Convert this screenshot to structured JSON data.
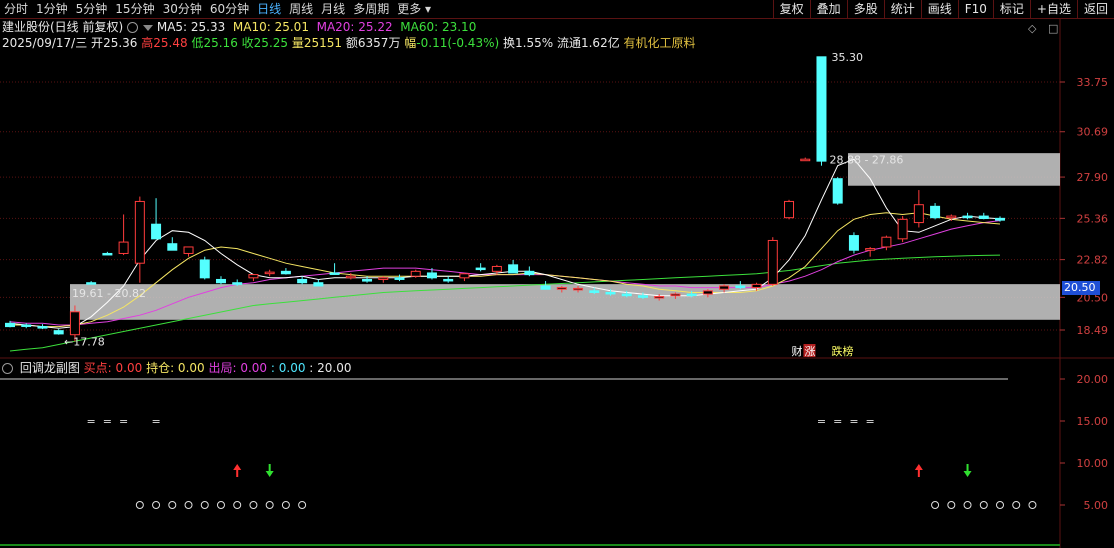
{
  "toolbar": {
    "tabs": [
      "分时",
      "1分钟",
      "5分钟",
      "15分钟",
      "30分钟",
      "60分钟",
      "日线",
      "周线",
      "月线",
      "多周期",
      "更多"
    ],
    "active_tab": "日线",
    "right_buttons": [
      "复权",
      "叠加",
      "多股",
      "统计",
      "画线",
      "F10",
      "标记",
      "+自选",
      "返回"
    ]
  },
  "header": {
    "stock_title": "建业股份(日线 前复权)",
    "ma5": "MA5: 25.33",
    "ma10": "MA10: 25.01",
    "ma20": "MA20: 25.22",
    "ma60": "MA60: 23.10",
    "date": "2025/09/17/三",
    "open_label": "开",
    "open": "25.36",
    "high_label": "高",
    "high": "25.48",
    "low_label": "低",
    "low": "25.16",
    "close_label": "收",
    "close": "25.25",
    "vol_label": "量",
    "vol": "25151",
    "amount_label": "额",
    "amount": "6357万",
    "change_label": "幅",
    "change": "-0.11(-0.43%)",
    "turnover_label": "换",
    "turnover": "1.55%",
    "float_label": "流通",
    "float": "1.62亿",
    "industry": "有机化工原料",
    "diamond": "◇",
    "box_icon": "□"
  },
  "price_tag": "20.50",
  "sub_header": {
    "name": "回调龙副图",
    "buy": "买点: 0.00",
    "hold": "持仓: 0.00",
    "exit": "出局: 0.00",
    "v1": ": 0.00",
    "v2": ": 20.00"
  },
  "colors": {
    "up": "#ff3c3c",
    "down": "#54ffff",
    "ma5": "#ffffff",
    "ma10": "#f5e663",
    "ma20": "#e040e0",
    "ma60": "#3ce03c",
    "grid": "#5a1212",
    "band": "#cfcfcf"
  },
  "chart_data": [
    {
      "type": "candlestick",
      "title": "建业股份(日线 前复权)",
      "y_ticks": [
        18.49,
        20.5,
        22.82,
        25.36,
        27.9,
        30.69,
        33.75
      ],
      "ylim": [
        17.5,
        36.0
      ],
      "annotations": [
        "35.30",
        "28.88 - 27.86",
        "19.61 - 20.82",
        "17.78"
      ],
      "event_labels": [
        "财",
        "涨",
        "跌榜"
      ],
      "zones": [
        {
          "label": "19.61 - 20.82",
          "low": 19.61,
          "high": 20.82
        },
        {
          "label": "28.88 - 27.86",
          "low": 27.86,
          "high": 28.88
        }
      ],
      "candles": [
        {
          "o": 18.9,
          "h": 19.05,
          "l": 18.65,
          "c": 18.7
        },
        {
          "o": 18.8,
          "h": 18.9,
          "l": 18.6,
          "c": 18.72
        },
        {
          "o": 18.7,
          "h": 18.85,
          "l": 18.55,
          "c": 18.65
        },
        {
          "o": 18.45,
          "h": 18.55,
          "l": 18.2,
          "c": 18.25
        },
        {
          "o": 18.2,
          "h": 20.0,
          "l": 17.78,
          "c": 19.61
        },
        {
          "o": 21.4,
          "h": 21.5,
          "l": 21.3,
          "c": 21.35
        },
        {
          "o": 23.2,
          "h": 23.3,
          "l": 23.1,
          "c": 23.15
        },
        {
          "o": 23.2,
          "h": 25.6,
          "l": 23.1,
          "c": 23.9
        },
        {
          "o": 22.6,
          "h": 26.7,
          "l": 21.4,
          "c": 26.4
        },
        {
          "o": 25.0,
          "h": 26.6,
          "l": 24.3,
          "c": 24.1
        },
        {
          "o": 23.8,
          "h": 24.2,
          "l": 23.5,
          "c": 23.4
        },
        {
          "o": 23.2,
          "h": 23.6,
          "l": 23.0,
          "c": 23.6
        },
        {
          "o": 22.8,
          "h": 23.0,
          "l": 21.6,
          "c": 21.7
        },
        {
          "o": 21.6,
          "h": 21.8,
          "l": 21.3,
          "c": 21.4
        },
        {
          "o": 21.4,
          "h": 21.6,
          "l": 21.2,
          "c": 21.3
        },
        {
          "o": 21.7,
          "h": 21.9,
          "l": 21.5,
          "c": 21.9
        },
        {
          "o": 22.0,
          "h": 22.2,
          "l": 21.8,
          "c": 22.05
        },
        {
          "o": 22.1,
          "h": 22.3,
          "l": 21.9,
          "c": 21.95
        },
        {
          "o": 21.6,
          "h": 21.8,
          "l": 21.3,
          "c": 21.4
        },
        {
          "o": 21.4,
          "h": 21.6,
          "l": 21.2,
          "c": 21.2
        },
        {
          "o": 22.0,
          "h": 22.6,
          "l": 21.9,
          "c": 21.95
        },
        {
          "o": 21.8,
          "h": 22.0,
          "l": 21.6,
          "c": 21.8
        },
        {
          "o": 21.6,
          "h": 21.8,
          "l": 21.4,
          "c": 21.5
        },
        {
          "o": 21.6,
          "h": 21.8,
          "l": 21.4,
          "c": 21.7
        },
        {
          "o": 21.7,
          "h": 21.9,
          "l": 21.5,
          "c": 21.6
        },
        {
          "o": 21.8,
          "h": 22.2,
          "l": 21.7,
          "c": 22.1
        },
        {
          "o": 22.0,
          "h": 22.3,
          "l": 21.6,
          "c": 21.7
        },
        {
          "o": 21.6,
          "h": 21.8,
          "l": 21.4,
          "c": 21.55
        },
        {
          "o": 21.7,
          "h": 22.0,
          "l": 21.5,
          "c": 21.95
        },
        {
          "o": 22.3,
          "h": 22.6,
          "l": 22.1,
          "c": 22.25
        },
        {
          "o": 22.1,
          "h": 22.5,
          "l": 21.9,
          "c": 22.4
        },
        {
          "o": 22.5,
          "h": 22.8,
          "l": 22.3,
          "c": 22.0
        },
        {
          "o": 22.1,
          "h": 22.4,
          "l": 21.8,
          "c": 21.9
        },
        {
          "o": 21.2,
          "h": 21.5,
          "l": 21.0,
          "c": 21.0
        },
        {
          "o": 21.0,
          "h": 21.2,
          "l": 20.8,
          "c": 21.1
        },
        {
          "o": 21.0,
          "h": 21.2,
          "l": 20.8,
          "c": 21.05
        },
        {
          "o": 20.9,
          "h": 21.1,
          "l": 20.7,
          "c": 20.8
        },
        {
          "o": 20.8,
          "h": 21.0,
          "l": 20.6,
          "c": 20.75
        },
        {
          "o": 20.7,
          "h": 20.9,
          "l": 20.5,
          "c": 20.6
        },
        {
          "o": 20.6,
          "h": 20.8,
          "l": 20.4,
          "c": 20.5
        },
        {
          "o": 20.5,
          "h": 20.7,
          "l": 20.3,
          "c": 20.55
        },
        {
          "o": 20.6,
          "h": 20.8,
          "l": 20.4,
          "c": 20.7
        },
        {
          "o": 20.7,
          "h": 20.9,
          "l": 20.5,
          "c": 20.65
        },
        {
          "o": 20.7,
          "h": 21.0,
          "l": 20.5,
          "c": 20.9
        },
        {
          "o": 21.0,
          "h": 21.3,
          "l": 20.8,
          "c": 21.2
        },
        {
          "o": 21.2,
          "h": 21.5,
          "l": 21.0,
          "c": 21.1
        },
        {
          "o": 21.1,
          "h": 21.4,
          "l": 20.9,
          "c": 21.3
        },
        {
          "o": 21.3,
          "h": 24.2,
          "l": 21.2,
          "c": 24.0
        },
        {
          "o": 25.4,
          "h": 26.5,
          "l": 25.3,
          "c": 26.4
        },
        {
          "o": 29.0,
          "h": 29.1,
          "l": 28.9,
          "c": 29.0
        },
        {
          "o": 35.3,
          "h": 35.3,
          "l": 28.6,
          "c": 28.88
        },
        {
          "o": 27.8,
          "h": 27.9,
          "l": 26.2,
          "c": 26.3
        },
        {
          "o": 24.3,
          "h": 24.5,
          "l": 23.2,
          "c": 23.4
        },
        {
          "o": 23.4,
          "h": 23.6,
          "l": 23.0,
          "c": 23.5
        },
        {
          "o": 23.6,
          "h": 24.3,
          "l": 23.4,
          "c": 24.2
        },
        {
          "o": 24.1,
          "h": 25.5,
          "l": 23.9,
          "c": 25.3
        },
        {
          "o": 25.1,
          "h": 27.1,
          "l": 24.8,
          "c": 26.2
        },
        {
          "o": 26.1,
          "h": 26.3,
          "l": 25.3,
          "c": 25.4
        },
        {
          "o": 25.4,
          "h": 25.6,
          "l": 25.2,
          "c": 25.5
        },
        {
          "o": 25.5,
          "h": 25.7,
          "l": 25.3,
          "c": 25.4
        },
        {
          "o": 25.5,
          "h": 25.7,
          "l": 25.3,
          "c": 25.35
        },
        {
          "o": 25.36,
          "h": 25.48,
          "l": 25.16,
          "c": 25.25
        }
      ],
      "ma5": [
        18.9,
        18.8,
        18.7,
        18.6,
        18.7,
        19.3,
        20.2,
        21.2,
        22.8,
        24.0,
        24.6,
        24.5,
        24.0,
        23.2,
        22.5,
        21.9,
        21.7,
        21.7,
        21.8,
        21.6,
        21.7,
        21.7,
        21.7,
        21.7,
        21.7,
        21.8,
        21.8,
        21.8,
        21.8,
        21.9,
        22.0,
        22.1,
        22.1,
        21.9,
        21.6,
        21.3,
        21.1,
        20.9,
        20.8,
        20.7,
        20.6,
        20.6,
        20.6,
        20.7,
        20.8,
        20.9,
        21.0,
        21.7,
        22.8,
        24.3,
        26.5,
        28.6,
        29.0,
        27.8,
        26.0,
        24.6,
        24.5,
        24.9,
        25.3,
        25.5,
        25.4,
        25.33
      ],
      "ma10": [
        18.8,
        18.8,
        18.7,
        18.7,
        18.8,
        19.0,
        19.4,
        19.9,
        20.6,
        21.4,
        22.2,
        22.9,
        23.4,
        23.6,
        23.5,
        23.2,
        22.9,
        22.6,
        22.4,
        22.2,
        22.0,
        21.9,
        21.8,
        21.8,
        21.8,
        21.8,
        21.8,
        21.8,
        21.8,
        21.8,
        21.9,
        21.9,
        22.0,
        21.9,
        21.8,
        21.7,
        21.6,
        21.5,
        21.3,
        21.2,
        21.0,
        20.9,
        20.8,
        20.8,
        20.8,
        20.8,
        20.9,
        21.2,
        21.7,
        22.4,
        23.5,
        24.6,
        25.3,
        25.6,
        25.7,
        25.6,
        25.7,
        25.5,
        25.3,
        25.2,
        25.1,
        25.01
      ],
      "ma20": [
        19.0,
        18.9,
        18.9,
        18.8,
        18.8,
        18.9,
        19.0,
        19.2,
        19.4,
        19.7,
        20.1,
        20.5,
        20.8,
        21.1,
        21.3,
        21.4,
        21.6,
        21.7,
        21.8,
        21.9,
        22.0,
        22.1,
        22.2,
        22.3,
        22.3,
        22.3,
        22.2,
        22.1,
        22.0,
        21.9,
        21.9,
        21.9,
        21.9,
        21.9,
        21.8,
        21.7,
        21.6,
        21.5,
        21.4,
        21.3,
        21.2,
        21.2,
        21.1,
        21.1,
        21.1,
        21.1,
        21.1,
        21.3,
        21.5,
        21.8,
        22.2,
        22.7,
        23.1,
        23.4,
        23.6,
        23.8,
        24.1,
        24.4,
        24.7,
        24.9,
        25.1,
        25.22
      ],
      "ma60": [
        17.2,
        17.3,
        17.4,
        17.6,
        17.8,
        18.0,
        18.2,
        18.4,
        18.6,
        18.8,
        19.0,
        19.2,
        19.4,
        19.6,
        19.8,
        20.0,
        20.1,
        20.2,
        20.3,
        20.4,
        20.5,
        20.6,
        20.7,
        20.8,
        20.85,
        20.9,
        20.95,
        21.0,
        21.05,
        21.1,
        21.15,
        21.2,
        21.25,
        21.3,
        21.35,
        21.4,
        21.45,
        21.5,
        21.55,
        21.6,
        21.65,
        21.7,
        21.75,
        21.8,
        21.85,
        21.9,
        21.95,
        22.05,
        22.15,
        22.3,
        22.45,
        22.6,
        22.7,
        22.8,
        22.85,
        22.9,
        22.95,
        23.0,
        23.03,
        23.06,
        23.08,
        23.1
      ]
    },
    {
      "type": "line",
      "title": "回调龙副图",
      "y_ticks": [
        5.0,
        10.0,
        15.0,
        20.0
      ],
      "ylim": [
        0,
        22
      ],
      "level_line": 20.0,
      "equals_groups": [
        [
          5,
          6,
          7,
          9
        ],
        [
          50,
          51,
          52,
          53
        ]
      ],
      "signals": [
        {
          "type": "up",
          "index": 14
        },
        {
          "type": "down",
          "index": 16
        },
        {
          "type": "up",
          "index": 56
        },
        {
          "type": "down",
          "index": 59
        }
      ],
      "circle_groups": [
        [
          8,
          9,
          10,
          11,
          12,
          13,
          14,
          15,
          16,
          17,
          18
        ],
        [
          57,
          58,
          59,
          60,
          61,
          62,
          63
        ]
      ]
    }
  ]
}
